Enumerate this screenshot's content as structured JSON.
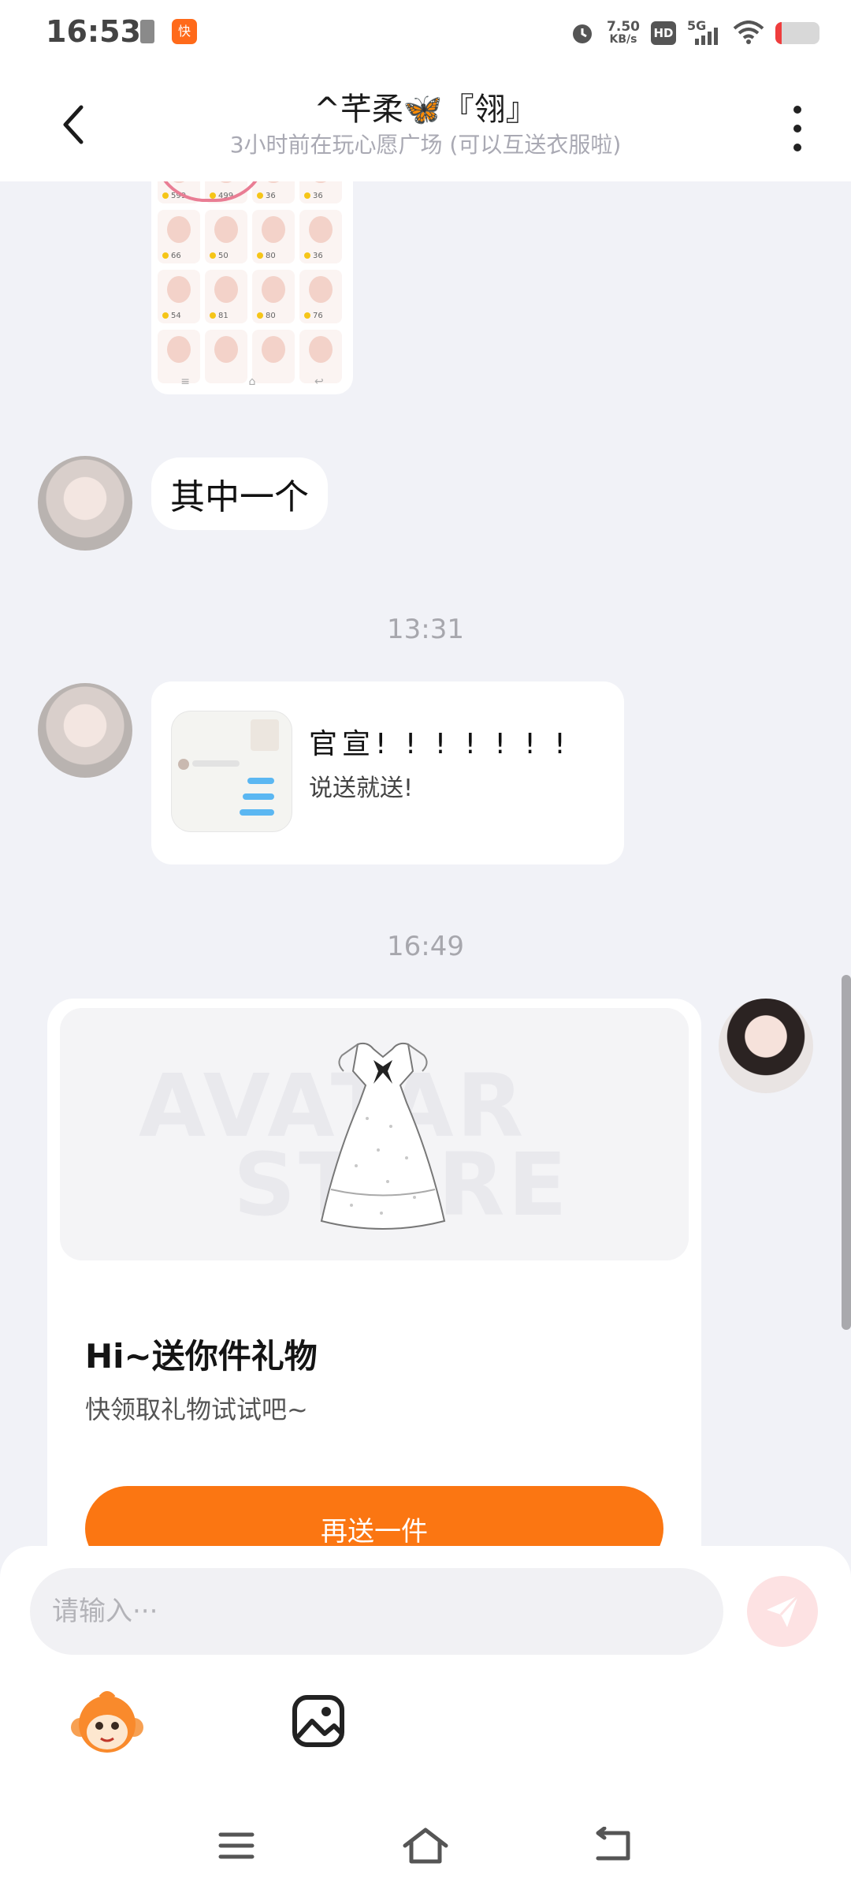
{
  "status_bar": {
    "time": "16:53",
    "app_badge_glyph": "快",
    "speed_value": "7.50",
    "speed_unit": "KB/s",
    "hd_label": "HD",
    "network_label": "5G",
    "battery_level": 0.15,
    "battery_color": "#ef3d3d"
  },
  "header": {
    "title": "^芊柔🦋『翎』",
    "subtitle": "3小时前在玩心愿广场 (可以互送衣服啦)"
  },
  "messages": {
    "shot_prices": [
      "599",
      "499",
      "36",
      "36",
      "66",
      "50",
      "80",
      "36",
      "54",
      "81",
      "80",
      "76",
      "",
      "",
      "",
      ""
    ],
    "text_message": "其中一个",
    "time_1": "13:31",
    "card_title": "官宣! ! ! ! ! ! !",
    "card_subtitle": "说送就送!",
    "time_2": "16:49"
  },
  "gift_card": {
    "watermark_line1": "AVATAR",
    "watermark_line2": "STORE",
    "title": "Hi~送你件礼物",
    "subtitle": "快领取礼物试试吧~",
    "button_label": "再送一件"
  },
  "input": {
    "placeholder": "请输入···"
  },
  "colors": {
    "accent": "#fb7612",
    "background": "#f1f2f7"
  },
  "icons": {
    "back": "chevron-left-icon",
    "more": "more-vertical-icon",
    "send": "paper-plane-icon",
    "sticker": "monkey-sticker-icon",
    "image": "image-icon",
    "nav_menu": "menu-icon",
    "nav_home": "home-icon",
    "nav_back": "return-icon"
  }
}
